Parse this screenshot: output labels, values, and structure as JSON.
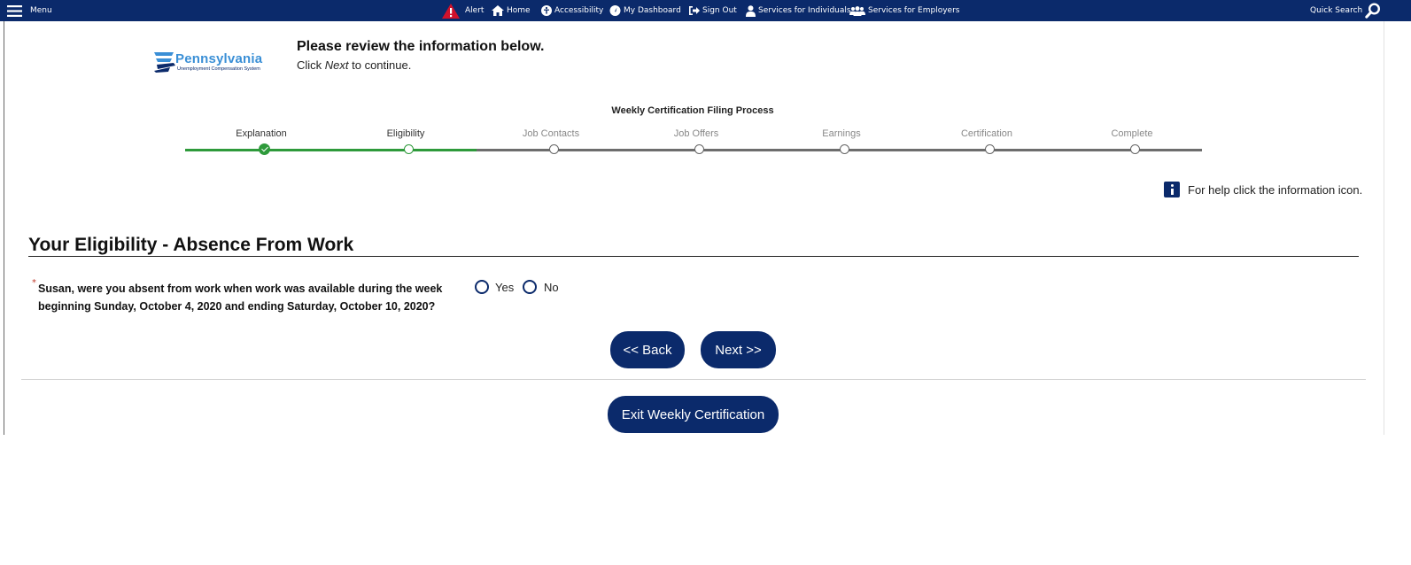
{
  "topnav": {
    "menu_label": "Menu",
    "alert_label": "Alert",
    "home_label": "Home",
    "accessibility_label": "Accessibility",
    "dashboard_label": "My Dashboard",
    "signout_label": "Sign Out",
    "services_individuals_label": "Services for Individuals",
    "services_employers_label": "Services for Employers",
    "quick_search_label": "Quick Search",
    "bar_color": "#0b2a6b"
  },
  "logo": {
    "word": "Pennsylvania",
    "subtitle": "Unemployment Compensation System"
  },
  "header": {
    "title": "Please review the information below.",
    "instruction_prefix": "Click ",
    "instruction_emphasis": "Next",
    "instruction_suffix": " to continue."
  },
  "progress": {
    "title": "Weekly Certification Filing Process",
    "steps": [
      {
        "label": "Explanation",
        "status": "complete"
      },
      {
        "label": "Eligibility",
        "status": "current"
      },
      {
        "label": "Job Contacts",
        "status": "pending"
      },
      {
        "label": "Job Offers",
        "status": "pending"
      },
      {
        "label": "Earnings",
        "status": "pending"
      },
      {
        "label": "Certification",
        "status": "pending"
      },
      {
        "label": "Complete",
        "status": "pending"
      }
    ],
    "complete_color": "#2e9a3b",
    "pending_color": "#6d6d6d"
  },
  "help": {
    "text": "For help click the information icon."
  },
  "section": {
    "title": "Your Eligibility - Absence From Work"
  },
  "question": {
    "required_marker": "*",
    "text": "Susan, were you absent from work when work was available during the week beginning Sunday, October 4, 2020 and ending Saturday, October 10, 2020?",
    "options": [
      "Yes",
      "No"
    ],
    "selected": null
  },
  "buttons": {
    "back_label": "<< Back",
    "next_label": "Next >>",
    "exit_label": "Exit Weekly Certification"
  }
}
